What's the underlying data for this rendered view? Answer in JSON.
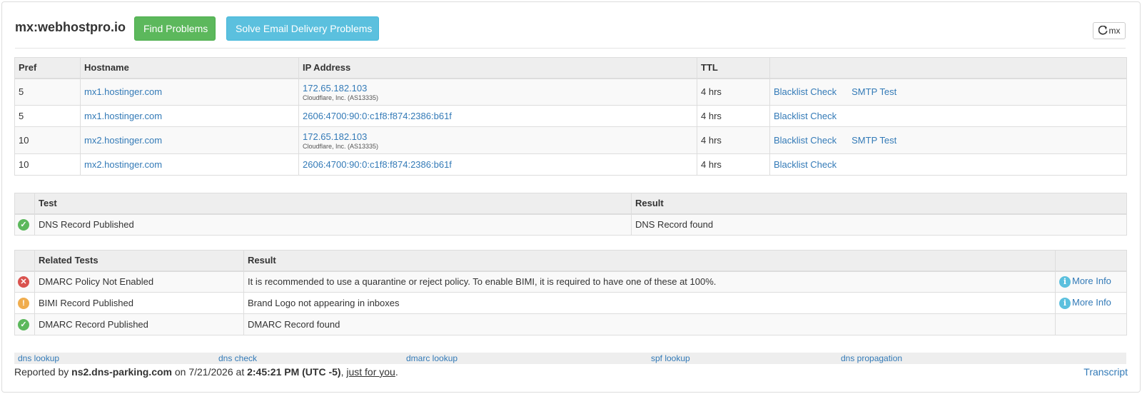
{
  "header": {
    "title": "mx:webhostpro.io",
    "find_problems": "Find Problems",
    "solve_email": "Solve Email Delivery Problems",
    "refresh_label": "mx"
  },
  "mx_table": {
    "columns": [
      "Pref",
      "Hostname",
      "IP Address",
      "TTL",
      ""
    ],
    "rows": [
      {
        "pref": "5",
        "hostname": "mx1.hostinger.com",
        "ip": "172.65.182.103",
        "ip_owner": "Cloudflare, Inc. (AS13335)",
        "ttl": "4 hrs",
        "blacklist": "Blacklist Check",
        "smtp": "SMTP Test"
      },
      {
        "pref": "5",
        "hostname": "mx1.hostinger.com",
        "ip": "2606:4700:90:0:c1f8:f874:2386:b61f",
        "ip_owner": "",
        "ttl": "4 hrs",
        "blacklist": "Blacklist Check",
        "smtp": ""
      },
      {
        "pref": "10",
        "hostname": "mx2.hostinger.com",
        "ip": "172.65.182.103",
        "ip_owner": "Cloudflare, Inc. (AS13335)",
        "ttl": "4 hrs",
        "blacklist": "Blacklist Check",
        "smtp": "SMTP Test"
      },
      {
        "pref": "10",
        "hostname": "mx2.hostinger.com",
        "ip": "2606:4700:90:0:c1f8:f874:2386:b61f",
        "ip_owner": "",
        "ttl": "4 hrs",
        "blacklist": "Blacklist Check",
        "smtp": ""
      }
    ]
  },
  "test_table": {
    "columns": [
      "",
      "Test",
      "Result"
    ],
    "rows": [
      {
        "status": "ok",
        "test": "DNS Record Published",
        "result": "DNS Record found"
      }
    ]
  },
  "related_table": {
    "columns": [
      "",
      "Related Tests",
      "Result",
      ""
    ],
    "rows": [
      {
        "status": "error",
        "test": "DMARC Policy Not Enabled",
        "result": "It is recommended to use a quarantine or reject policy. To enable BIMI, it is required to have one of these at 100%.",
        "more": "More Info"
      },
      {
        "status": "warning",
        "test": "BIMI Record Published",
        "result": "Brand Logo not appearing in inboxes",
        "more": "More Info"
      },
      {
        "status": "ok",
        "test": "DMARC Record Published",
        "result": "DMARC Record found",
        "more": ""
      }
    ]
  },
  "footer": {
    "links": [
      "dns lookup",
      "dns check",
      "dmarc lookup",
      "spf lookup",
      "dns propagation"
    ],
    "reported_prefix": "Reported by ",
    "server": "ns2.dns-parking.com",
    "on": " on ",
    "date": "7/21/2026",
    "at": " at ",
    "time": "2:45:21 PM (UTC -5)",
    "comma": ", ",
    "just_for_you": "just for you",
    "period": ".",
    "transcript": "Transcript"
  },
  "colors": {
    "success": "#5cb85c",
    "info": "#5bc0de",
    "error": "#d9534f",
    "warning": "#f0ad4e",
    "link": "#337ab7"
  },
  "icons": {
    "refresh": "refresh-icon",
    "ok": "check-circle-icon",
    "error": "x-circle-icon",
    "warning": "exclamation-circle-icon",
    "info": "info-circle-icon"
  }
}
